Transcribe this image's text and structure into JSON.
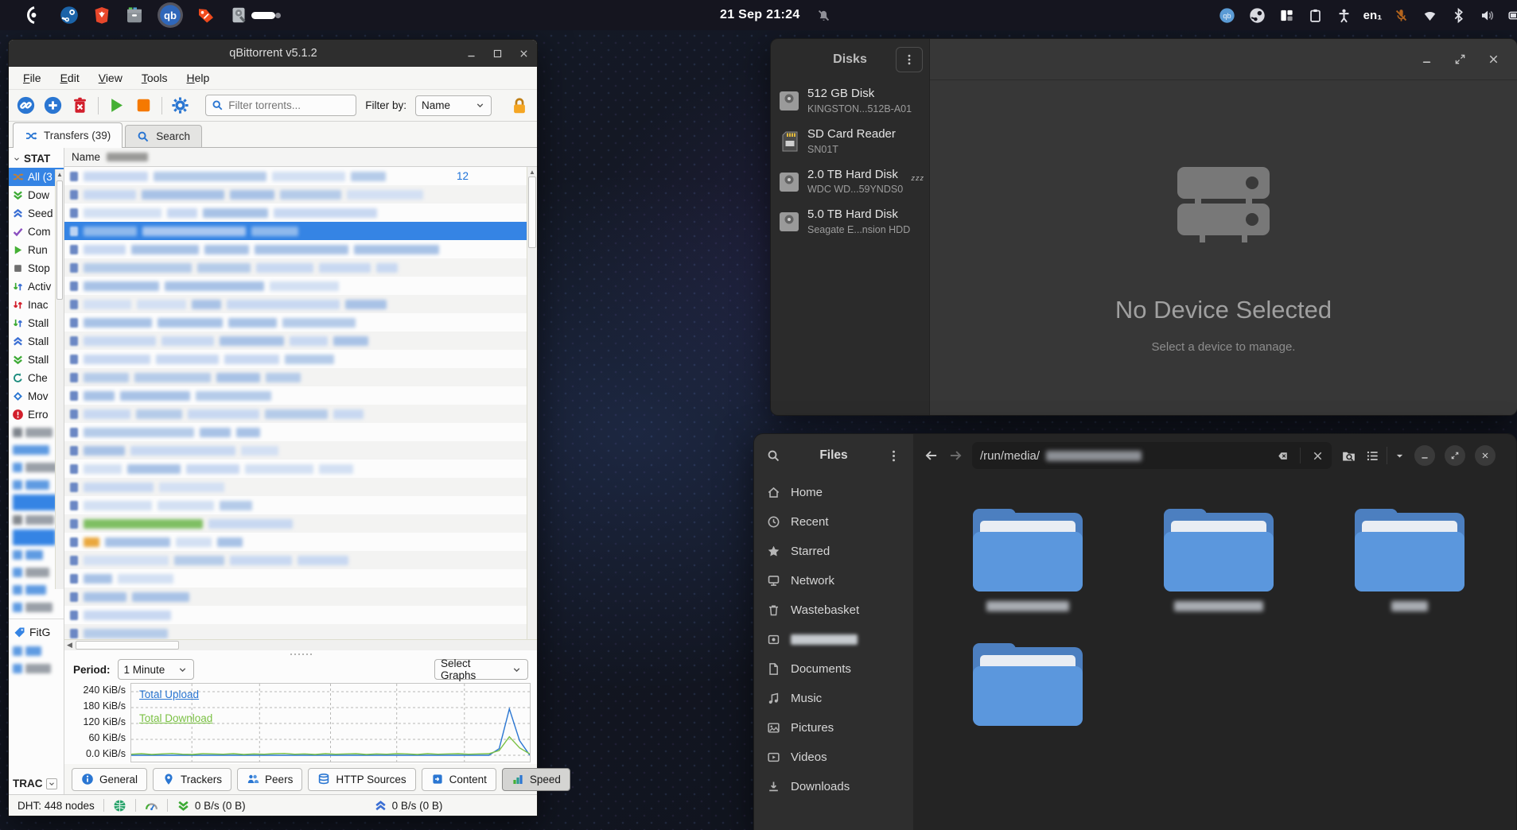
{
  "colors": {
    "accent_blue": "#3584e4",
    "qb_green": "#45b035",
    "qb_orange": "#f57900",
    "qb_red": "#d21f2c"
  },
  "panel": {
    "clock": "21 Sep 21:24",
    "keyboard_layout": "en₁",
    "left_icons": [
      "launcher",
      "steam",
      "brave",
      "archive",
      "qbittorrent",
      "tag",
      "disks-utility"
    ],
    "right_icons": [
      "qbittorrent-tray",
      "steam-tray",
      "tiling",
      "clipboard",
      "accessibility",
      "keyboard-layout",
      "mic-muted",
      "wifi",
      "bluetooth",
      "volume",
      "battery"
    ]
  },
  "qbittorrent": {
    "title": "qBittorrent v5.1.2",
    "menu_items": [
      "File",
      "Edit",
      "View",
      "Tools",
      "Help"
    ],
    "toolbar": {
      "filter_placeholder": "Filter torrents...",
      "filter_by_label": "Filter by:",
      "filter_by_value": "Name"
    },
    "tabs": [
      {
        "label": "Transfers (39)",
        "icon": "shuffle-blue",
        "active": true
      },
      {
        "label": "Search",
        "icon": "search-blue",
        "active": false
      }
    ],
    "status_panel": {
      "header": "STAT",
      "items": [
        {
          "label": "All (3",
          "icon": "shuffle-orange",
          "selected": true
        },
        {
          "label": "Dow",
          "icon": "chev2-down-green"
        },
        {
          "label": "Seed",
          "icon": "chev2-up-blue"
        },
        {
          "label": "Com",
          "icon": "check-purple"
        },
        {
          "label": "Run",
          "icon": "play-small"
        },
        {
          "label": "Stop",
          "icon": "square-gray"
        },
        {
          "label": "Activ",
          "icon": "updown-gb"
        },
        {
          "label": "Inac",
          "icon": "updown-red"
        },
        {
          "label": "Stall",
          "icon": "updown-gb"
        },
        {
          "label": "Stall",
          "icon": "chev2-up-blue"
        },
        {
          "label": "Stall",
          "icon": "chev2-down-green"
        },
        {
          "label": "Che",
          "icon": "refresh-teal"
        },
        {
          "label": "Mov",
          "icon": "diamond-blue"
        },
        {
          "label": "Erro",
          "icon": "error-red"
        }
      ],
      "category_item": {
        "label": "FitG",
        "icon": "tag-blue"
      },
      "trackers_header": "TRAC"
    },
    "table": {
      "columns": [
        "Name"
      ],
      "row_count": 26,
      "selected_row": 3,
      "first_row_value": "12"
    },
    "graph": {
      "period_label": "Period:",
      "period_value": "1 Minute",
      "select_graphs_label": "Select Graphs",
      "unit": "KiB/s",
      "y_ticks": [
        "240 KiB/s",
        "180 KiB/s",
        "120 KiB/s",
        "60 KiB/s",
        "0.0 KiB/s"
      ],
      "series": [
        {
          "name": "Total Upload",
          "color": "#2a76d2",
          "values": [
            0,
            0,
            0,
            0,
            0,
            0,
            0,
            0,
            0,
            0,
            0,
            0,
            0,
            0,
            0,
            0,
            0,
            0,
            0,
            0,
            0,
            0,
            0,
            0,
            0,
            0,
            0,
            0,
            0,
            0,
            0,
            0,
            0,
            0,
            0,
            0,
            25,
            175,
            55,
            0
          ]
        },
        {
          "name": "Total Download",
          "color": "#7bc144",
          "values": [
            4,
            6,
            3,
            5,
            7,
            4,
            3,
            6,
            5,
            4,
            6,
            3,
            5,
            4,
            6,
            7,
            4,
            5,
            3,
            6,
            4,
            5,
            6,
            3,
            5,
            4,
            6,
            5,
            3,
            6,
            4,
            5,
            6,
            4,
            5,
            6,
            18,
            70,
            28,
            5
          ]
        }
      ]
    },
    "bottom_tabs": [
      {
        "label": "General",
        "icon": "info-blue"
      },
      {
        "label": "Trackers",
        "icon": "pin-blue"
      },
      {
        "label": "Peers",
        "icon": "peers-blue"
      },
      {
        "label": "HTTP Sources",
        "icon": "stack-blue"
      },
      {
        "label": "Content",
        "icon": "content-blue"
      },
      {
        "label": "Speed",
        "icon": "speed-bars",
        "active": true
      }
    ],
    "statusbar": {
      "dht": "DHT: 448 nodes",
      "download_speed": "0 B/s (0 B)",
      "upload_speed": "0 B/s (0 B)"
    }
  },
  "disks": {
    "title": "Disks",
    "devices": [
      {
        "name": "512 GB Disk",
        "detail": "KINGSTON...512B-A01",
        "icon": "drive-gray",
        "sleeping": false
      },
      {
        "name": "SD Card Reader",
        "detail": "SN01T",
        "icon": "sdcard",
        "sleeping": false
      },
      {
        "name": "2.0 TB Hard Disk",
        "detail": "WDC WD...59YNDS0",
        "icon": "drive-gray",
        "sleeping": true
      },
      {
        "name": "5.0 TB Hard Disk",
        "detail": "Seagate E...nsion HDD",
        "icon": "drive-gray",
        "sleeping": false
      }
    ],
    "empty_state": {
      "title": "No Device Selected",
      "subtitle": "Select a device to manage."
    }
  },
  "files": {
    "title": "Files",
    "path": "/run/media/",
    "sidebar": [
      {
        "label": "Home",
        "icon": "home"
      },
      {
        "label": "Recent",
        "icon": "clock"
      },
      {
        "label": "Starred",
        "icon": "star"
      },
      {
        "label": "Network",
        "icon": "network"
      },
      {
        "label": "Wastebasket",
        "icon": "trash"
      },
      {
        "label": "",
        "icon": "drive-mini",
        "redacted": true
      },
      {
        "label": "Documents",
        "icon": "doc"
      },
      {
        "label": "Music",
        "icon": "music"
      },
      {
        "label": "Pictures",
        "icon": "picture"
      },
      {
        "label": "Videos",
        "icon": "video"
      },
      {
        "label": "Downloads",
        "icon": "download"
      }
    ],
    "folders": [
      {
        "name_redacted": true
      },
      {
        "name_redacted": true
      },
      {
        "name_redacted": true
      },
      {
        "name_redacted": true
      }
    ]
  }
}
